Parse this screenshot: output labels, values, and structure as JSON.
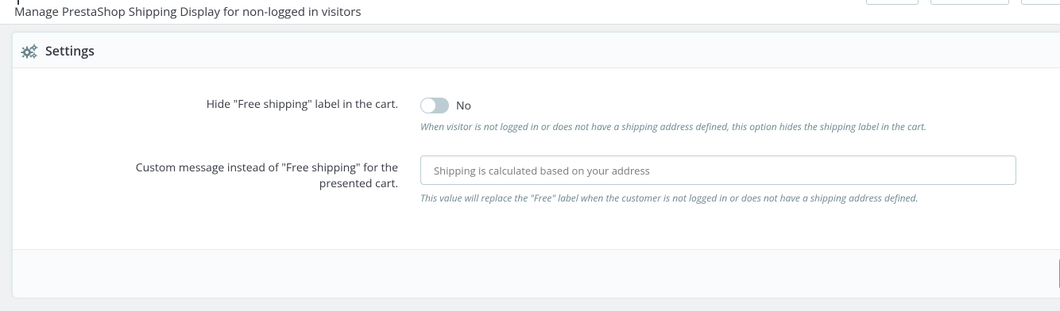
{
  "header": {
    "subtitle": "Manage PrestaShop Shipping Display for non-logged in visitors"
  },
  "panel": {
    "title": "Settings",
    "icon": "gears-icon"
  },
  "fields": {
    "hide_label": {
      "label": "Hide \"Free shipping\" label in the cart.",
      "state": "No",
      "enabled": false,
      "help": "When visitor is not logged in or does not have a shipping address defined, this option hides the shipping label in the cart."
    },
    "custom_message": {
      "label_line1": "Custom message instead of \"Free shipping\" for the",
      "label_line2": "presented cart.",
      "value": "",
      "placeholder": "Shipping is calculated based on your address",
      "help": "This value will replace the \"Free\" label when the customer is not logged in or does not have a shipping address defined."
    }
  },
  "colors": {
    "accent": "#25b9d7",
    "switch_off": "#bbcdd2",
    "help_text": "#6c868e"
  }
}
